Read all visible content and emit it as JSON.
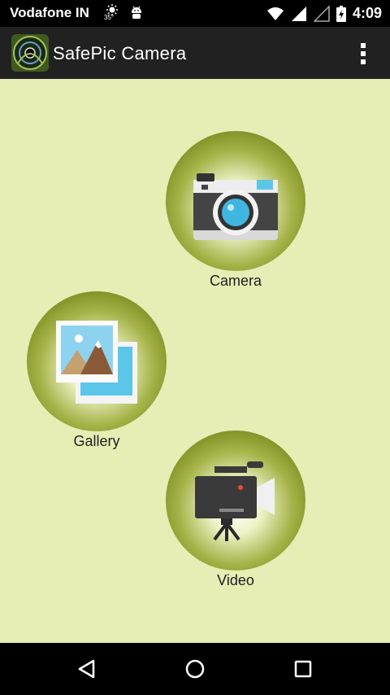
{
  "status_bar": {
    "carrier": "Vodafone IN",
    "temperature": "35°",
    "time": "4:09",
    "icons": [
      "weather-sun-icon",
      "android-debug-icon",
      "wifi-icon",
      "signal-icon",
      "signal-empty-icon",
      "battery-charging-icon"
    ]
  },
  "app_bar": {
    "title": "SafePic Camera",
    "logo_icon": "app-logo-icon",
    "menu_icon": "overflow-menu-icon"
  },
  "tiles": [
    {
      "label": "Camera",
      "icon": "camera-icon"
    },
    {
      "label": "Gallery",
      "icon": "gallery-icon"
    },
    {
      "label": "Video",
      "icon": "video-camera-icon"
    }
  ],
  "nav_bar": {
    "buttons": [
      "back-icon",
      "home-icon",
      "recents-icon"
    ]
  },
  "colors": {
    "background": "#e7edb5",
    "app_bar": "#212121",
    "circle_dark": "#6e7d18",
    "status_bar": "#000000"
  }
}
